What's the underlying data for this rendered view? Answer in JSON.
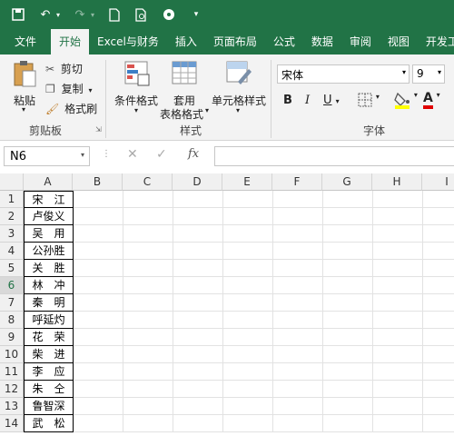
{
  "tabs": [
    "文件",
    "开始",
    "Excel与财务",
    "插入",
    "页面布局",
    "公式",
    "数据",
    "审阅",
    "视图",
    "开发工"
  ],
  "active_tab_index": 1,
  "clipboard": {
    "paste": "粘贴",
    "cut": "剪切",
    "copy": "复制",
    "format_painter": "格式刷",
    "group": "剪贴板"
  },
  "styles": {
    "conditional": "条件格式",
    "table_line1": "套用",
    "table_line2": "表格格式",
    "cell_styles": "单元格样式",
    "group": "样式"
  },
  "font": {
    "name": "宋体",
    "size": "9",
    "bold": "B",
    "italic": "I",
    "underline": "U",
    "group": "字体",
    "text_color": "A"
  },
  "namebox": "N6",
  "fx": "fx",
  "columns": [
    "A",
    "B",
    "C",
    "D",
    "E",
    "F",
    "G",
    "H",
    "I"
  ],
  "rows": [
    {
      "n": "1",
      "v": "宋　江"
    },
    {
      "n": "2",
      "v": "卢俊义"
    },
    {
      "n": "3",
      "v": "吴　用"
    },
    {
      "n": "4",
      "v": "公孙胜"
    },
    {
      "n": "5",
      "v": "关　胜"
    },
    {
      "n": "6",
      "v": "林　冲"
    },
    {
      "n": "7",
      "v": "秦　明"
    },
    {
      "n": "8",
      "v": "呼延灼"
    },
    {
      "n": "9",
      "v": "花　荣"
    },
    {
      "n": "10",
      "v": "柴　进"
    },
    {
      "n": "11",
      "v": "李　应"
    },
    {
      "n": "12",
      "v": "朱　仝"
    },
    {
      "n": "13",
      "v": "鲁智深"
    },
    {
      "n": "14",
      "v": "武　松"
    }
  ],
  "colors": {
    "accent": "#217346"
  }
}
